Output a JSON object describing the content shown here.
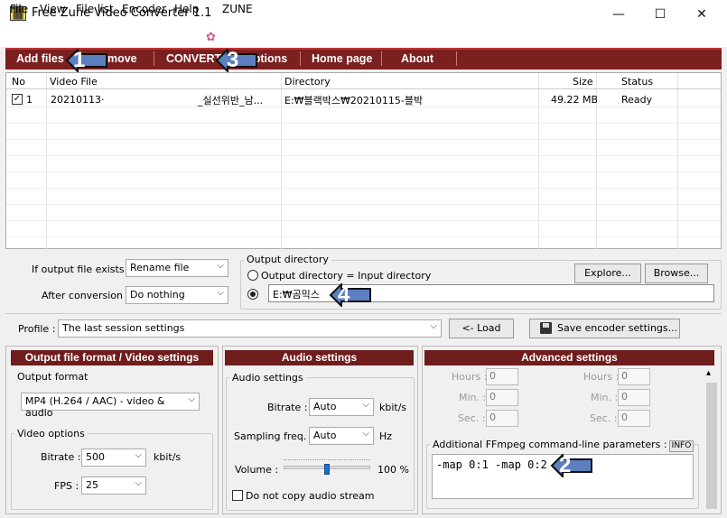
{
  "window": {
    "title": "Free Zune Video Converter 1.1",
    "minimize": "—",
    "maximize": "☐",
    "close": "✕"
  },
  "menu": [
    "File",
    "View",
    "File list",
    "Encoder",
    "Help",
    "ZUNE"
  ],
  "toolbar": {
    "add": "Add files",
    "remove": "Remove",
    "convert": "CONVERT",
    "options": "Options",
    "home": "Home page",
    "about": "About"
  },
  "list": {
    "headers": {
      "no": "No",
      "file": "Video File",
      "dir": "Directory",
      "size": "Size",
      "status": "Status"
    },
    "rows": [
      {
        "no": "1",
        "file": "20210113·",
        "file_tail": "_실선위반_남...",
        "dir": "E:₩블랙박스₩20210115-블박",
        "size": "49.22 MB",
        "status": "Ready",
        "checked": "✓"
      }
    ]
  },
  "options": {
    "if_exists_label": "If output file exists :",
    "if_exists_value": "Rename file",
    "after_label": "After conversion :",
    "after_value": "Do nothing",
    "outdir_group": "Output directory",
    "outdir_same": "Output directory = Input directory",
    "outdir_path": "E:₩곰믹스",
    "explore": "Explore...",
    "browse": "Browse..."
  },
  "profile": {
    "label": "Profile :",
    "value": "The last session settings",
    "load": "<- Load",
    "save": "Save encoder settings..."
  },
  "video": {
    "header": "Output file format / Video settings",
    "format_label": "Output format",
    "format_value": "MP4 (H.264 / AAC) - video & audio",
    "options_label": "Video options",
    "bitrate_label": "Bitrate :",
    "bitrate_value": "500",
    "bitrate_unit": "kbit/s",
    "fps_label": "FPS :",
    "fps_value": "25"
  },
  "audio": {
    "header": "Audio settings",
    "group": "Audio settings",
    "bitrate_label": "Bitrate :",
    "bitrate_value": "Auto",
    "bitrate_unit": "kbit/s",
    "sampling_label": "Sampling freq. :",
    "sampling_value": "Auto",
    "sampling_unit": "Hz",
    "volume_label": "Volume :",
    "volume_value": "100 %",
    "volume_level": 0.5,
    "no_copy": "Do not copy audio stream"
  },
  "advanced": {
    "header": "Advanced settings",
    "hours": "Hours :",
    "min": "Min. :",
    "sec": "Sec. :",
    "zero": "0",
    "ffmpeg_label": "Additional FFmpeg command-line parameters :",
    "info": "INFO",
    "ffmpeg_value": "-map 0:1 -map 0:2"
  },
  "callouts": [
    "1",
    "2",
    "3",
    "4"
  ],
  "colors": {
    "toolbar": "#7b1f1f",
    "panel_header": "#6f1c1c",
    "callout": "#5b7fc0"
  }
}
